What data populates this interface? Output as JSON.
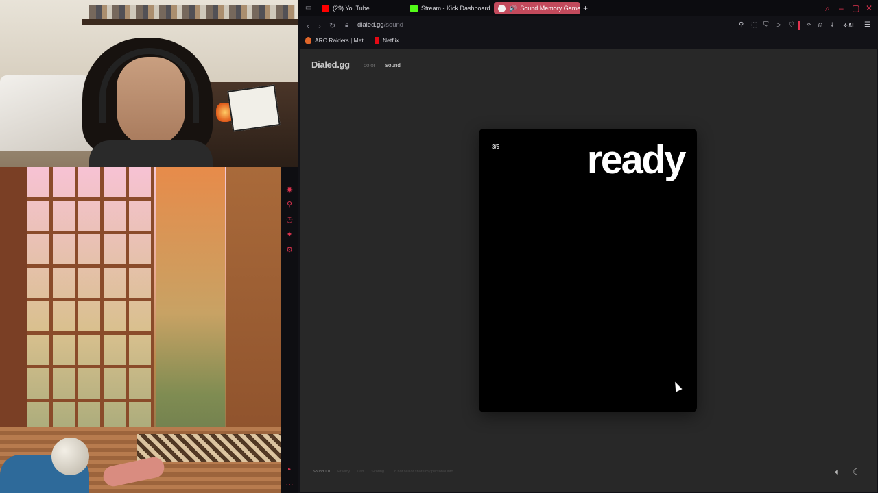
{
  "browser": {
    "tabs": [
      {
        "label": "(29) YouTube",
        "favicon_color": "#ff0000",
        "active": false
      },
      {
        "label": "Stream - Kick Dashboard",
        "favicon_color": "#53fc18",
        "active": false
      },
      {
        "label": "Sound Memory Game",
        "favicon_color": "#ffffff",
        "active": true
      }
    ],
    "new_tab_label": "+",
    "url_host": "dialed.gg",
    "url_path": "/sound",
    "ai_label": "AI",
    "bookmarks": [
      {
        "label": "ARC Raiders | Met...",
        "icon_color": "#e0662a"
      },
      {
        "label": "Netflix",
        "icon_color": "#e50914"
      }
    ],
    "accent_color": "#e0334f"
  },
  "site": {
    "logo": "Dialed.gg",
    "nav": [
      "color",
      "sound"
    ],
    "active_nav": "sound"
  },
  "game": {
    "progress": "3/5",
    "status": "ready"
  },
  "footer": {
    "version": "Sound 1.0",
    "links": [
      "Privacy",
      "Lab",
      "Scoring",
      "Do not sell or share my personal info"
    ]
  },
  "footer_icons": [
    "speaker-icon",
    "moon-icon"
  ]
}
